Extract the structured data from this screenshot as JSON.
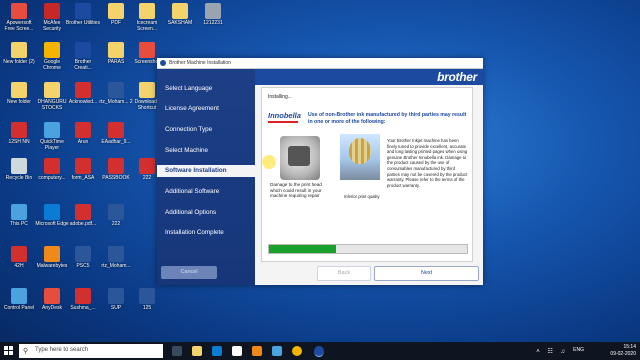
{
  "desktop": {
    "icons": [
      {
        "label": "Apowersoft Free Scree...",
        "color": "#e84c3d"
      },
      {
        "label": "McAfee Security Scan...",
        "color": "#c62828"
      },
      {
        "label": "Brother Utilities",
        "color": "#1c4aa1"
      },
      {
        "label": "PDF",
        "color": "#f3d36a"
      },
      {
        "label": "Icecream Screen...",
        "color": "#f3d36a"
      },
      {
        "label": "SAKSHAM",
        "color": "#f3d36a"
      },
      {
        "label": "1212231",
        "color": "#9aa3b0"
      },
      {
        "label": "New folder (2)",
        "color": "#f3d36a"
      },
      {
        "label": "Google Chrome",
        "color": "#f4b400"
      },
      {
        "label": "Brother Creati...",
        "color": "#1c4aa1"
      },
      {
        "label": "PARAS",
        "color": "#f3d36a"
      },
      {
        "label": "Screenshot",
        "color": "#e84c3d"
      },
      {
        "label": "New folder",
        "color": "#f3d36a"
      },
      {
        "label": "DHANGURU STOCKS",
        "color": "#f3d36a"
      },
      {
        "label": "Acknowled...",
        "color": "#d32f2f"
      },
      {
        "label": "rtz_Moham... 2",
        "color": "#2b579a"
      },
      {
        "label": "Downloads Shortcut",
        "color": "#f3d36a"
      },
      {
        "label": "12SH NN",
        "color": "#d32f2f"
      },
      {
        "label": "QuickTime Player",
        "color": "#4aa3df"
      },
      {
        "label": "Arun",
        "color": "#d32f2f"
      },
      {
        "label": "EAadhar_9...",
        "color": "#d32f2f"
      },
      {
        "label": "Recycle Bin",
        "color": "#cfd8dc"
      },
      {
        "label": "computery...",
        "color": "#d32f2f"
      },
      {
        "label": "form_ASA",
        "color": "#d32f2f"
      },
      {
        "label": "PASSBOOK",
        "color": "#d32f2f"
      },
      {
        "label": "222",
        "color": "#d32f2f"
      },
      {
        "label": "This PC",
        "color": "#4aa3df"
      },
      {
        "label": "Microsoft Edge",
        "color": "#0a7cd6"
      },
      {
        "label": "adobe.pdf...",
        "color": "#d32f2f"
      },
      {
        "label": "222",
        "color": "#2b579a"
      },
      {
        "label": "42H",
        "color": "#d32f2f"
      },
      {
        "label": "Malwarebytes",
        "color": "#ef8a1a"
      },
      {
        "label": "PSC5",
        "color": "#2b579a"
      },
      {
        "label": "rtz_Moham...",
        "color": "#2b579a"
      },
      {
        "label": "Control Panel",
        "color": "#4aa3df"
      },
      {
        "label": "AnyDesk",
        "color": "#e84c3d"
      },
      {
        "label": "Sushma_...",
        "color": "#d32f2f"
      },
      {
        "label": "SUP",
        "color": "#2b579a"
      },
      {
        "label": "125",
        "color": "#2b579a"
      }
    ]
  },
  "window": {
    "title": "Brother Machine Installation",
    "brand": "brother",
    "steps": [
      "Select Language",
      "License Agreement",
      "Connection Type",
      "Select Machine",
      "Software Installation",
      "Additional Software",
      "Additional Options",
      "Installation Complete"
    ],
    "active_step_index": 4,
    "status": "Installing...",
    "logo_text": "Innobella",
    "warning": "Use of non-Brother ink manufactured by third parties may result in one or more of the following:",
    "caption_damage": "Damage to the print head which could result in your machine requiring repair",
    "caption_quality": "Inferior print quality",
    "description": "Your Brother Inkjet machine has been finely tuned to provide excellent, accurate and long lasting printed pages when using genuine Brother Innobella ink. Damage to the product caused by the use of consumables manufactured by third parties may not be covered by the product warranty. Please refer to the terms of the product warranty.",
    "progress_percent": 34,
    "progress_color": "#19a12c",
    "buttons": {
      "cancel": "Cancel",
      "back": "Back",
      "next": "Next"
    }
  },
  "taskbar": {
    "search_placeholder": "Type here to search",
    "language": "ENG",
    "time": "15:14",
    "date": "09-02-2020"
  }
}
